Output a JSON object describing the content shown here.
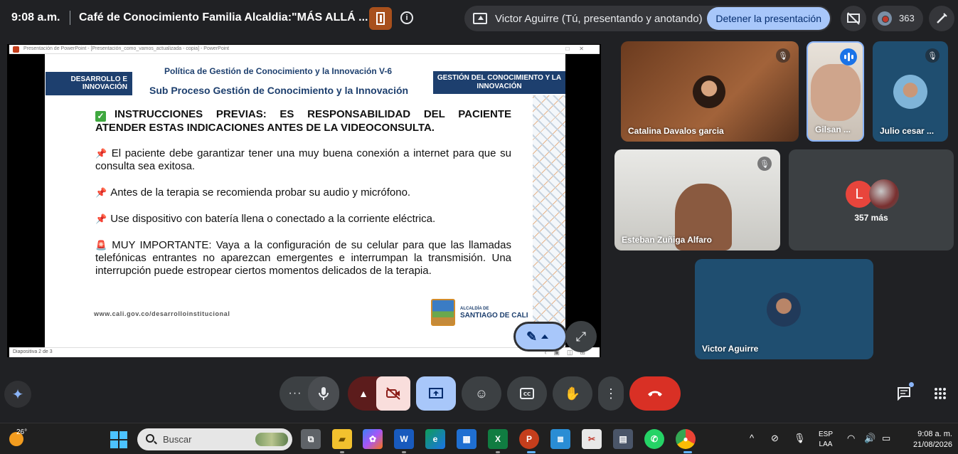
{
  "meeting": {
    "time": "9:08 a.m.",
    "title": "Café de Conocimiento Familia Alcaldia:\"MÁS ALLÁ ...",
    "presenting_text": "Victor Aguirre (Tú, presentando y anotando)",
    "stop_presenting_label": "Detener la presentación",
    "participants_count": "363",
    "accent_color": "#a8c7fa",
    "end_call_color": "#d93025"
  },
  "ppt": {
    "window_title": "Presentación de PowerPoint - [Presentación_como_vamos_actualizada - copia] - PowerPoint",
    "status_left": "Diapositiva 2 de 3"
  },
  "slide": {
    "header_left": "DESARROLLO E INNOVACIÓN",
    "header_right": "GESTIÓN DEL CONOCIMIENTO Y LA INNOVACIÓN",
    "title1": "Política de Gestión de Conocimiento y la Innovación V-6",
    "title2": "Sub Proceso Gestión de Conocimiento y la Innovación",
    "heading": "INSTRUCCIONES PREVIAS: ES RESPONSABILIDAD DEL PACIENTE ATENDER ESTAS INDICACIONES ANTES DE LA VIDEOCONSULTA.",
    "items": [
      "El paciente debe  garantizar tener una muy buena conexión a internet para que su consulta sea exitosa.",
      "Antes de la terapia se recomienda probar su audio y micrófono.",
      "Use dispositivo con batería llena o conectado a la corriente eléctrica.",
      "MUY IMPORTANTE: Vaya a la configuración de su celular para que las llamadas telefónicas entrantes no aparezcan emergentes e interrumpan la transmisión. Una interrupción puede estropear ciertos momentos delicados de la terapia."
    ],
    "url": "www.cali.gov.co/desarrolloinstitucional",
    "logo_small": "ALCALDÍA DE",
    "logo_big": "SANTIAGO DE CALI"
  },
  "participants": [
    {
      "name": "Catalina Davalos garcia",
      "muted": true
    },
    {
      "name": "Gilsan ...",
      "speaking": true
    },
    {
      "name": "Julio cesar ...",
      "muted": true
    },
    {
      "name": "Esteban Zuñiga Alfaro",
      "muted": true
    },
    {
      "name": "357 más",
      "initial": "L"
    },
    {
      "name": "Victor Aguirre"
    }
  ],
  "taskbar": {
    "temperature": "26°",
    "search_placeholder": "Buscar",
    "lang_line1": "ESP",
    "lang_line2": "LAA",
    "clock_time": "9:08 a. m.",
    "clock_date": "21/08/2026"
  }
}
